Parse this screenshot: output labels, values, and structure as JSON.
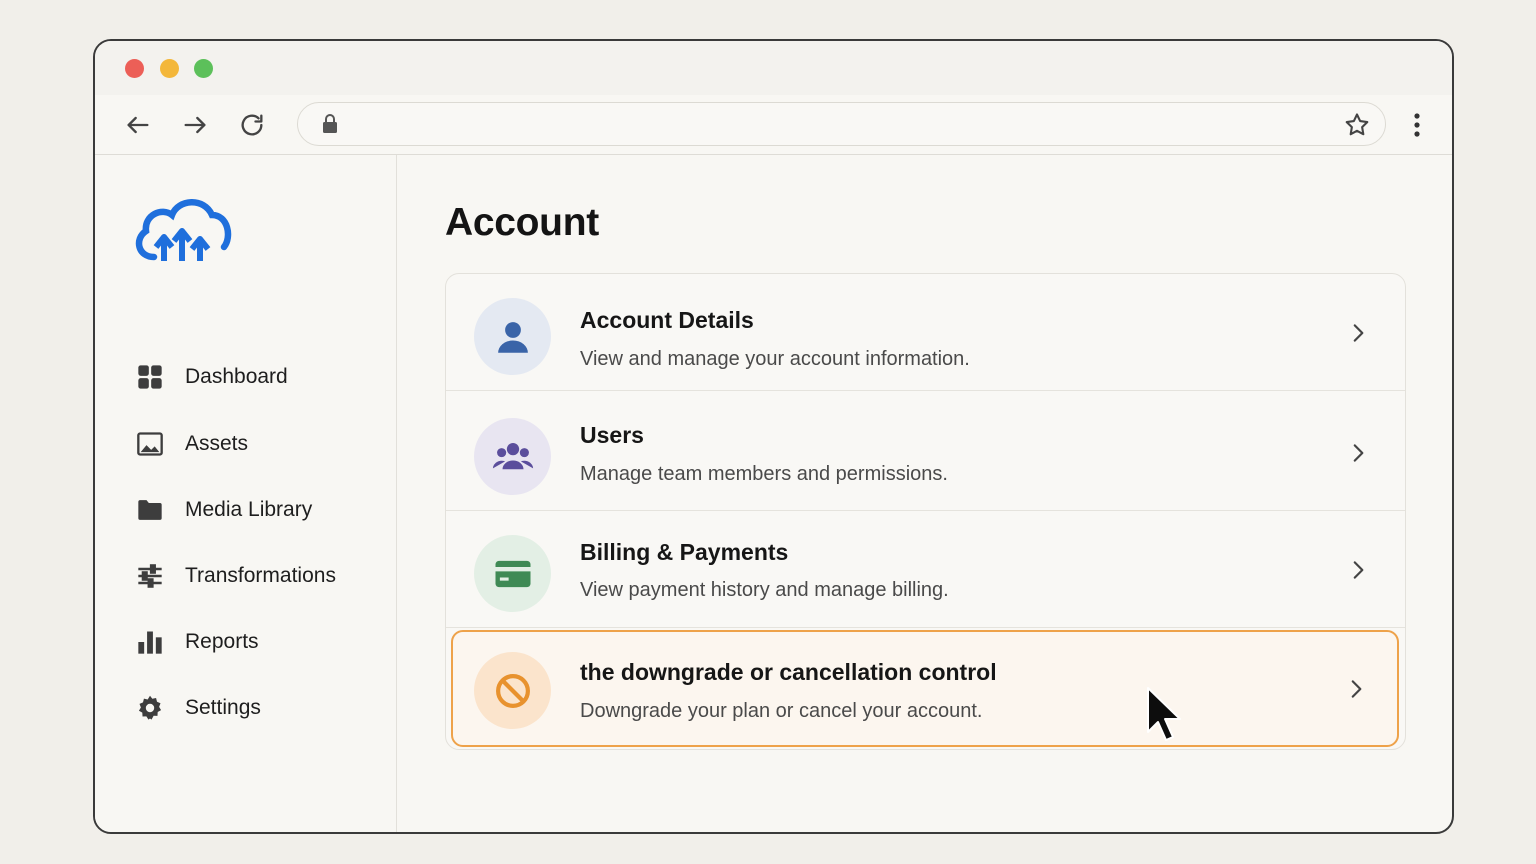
{
  "browser": {
    "address_value": "",
    "colors": {
      "close": "#ec5f57",
      "minimize": "#f3b73a",
      "maximize": "#5cc05a"
    }
  },
  "sidebar": {
    "items": [
      {
        "label": "Dashboard",
        "icon": "grid-icon"
      },
      {
        "label": "Assets",
        "icon": "image-icon"
      },
      {
        "label": "Media Library",
        "icon": "folder-icon"
      },
      {
        "label": "Transformations",
        "icon": "sliders-icon"
      },
      {
        "label": "Reports",
        "icon": "bar-chart-icon"
      },
      {
        "label": "Settings",
        "icon": "gear-icon"
      }
    ]
  },
  "main": {
    "title": "Account",
    "rows": [
      {
        "title": "Account Details",
        "description": "View and manage your account information.",
        "icon": "user-icon",
        "accent": "#3a64a8"
      },
      {
        "title": "Users",
        "description": "Manage team members and permissions.",
        "icon": "users-icon",
        "accent": "#5b4e9c"
      },
      {
        "title": "Billing & Payments",
        "description": "View payment history and manage billing.",
        "icon": "credit-card-icon",
        "accent": "#3f8a55"
      },
      {
        "title": "the downgrade or cancellation control",
        "description": "Downgrade your plan or cancel your account.",
        "icon": "ban-icon",
        "accent": "#e8922e"
      }
    ]
  },
  "brand": {
    "color": "#1f6fdc",
    "logo": "cloud-upload-logo"
  }
}
